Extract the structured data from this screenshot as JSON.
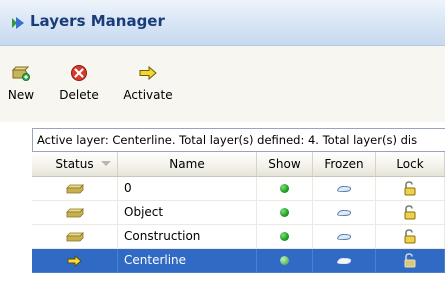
{
  "window": {
    "title": "Layers Manager"
  },
  "toolbar": {
    "new_label": "New",
    "delete_label": "Delete",
    "activate_label": "Activate"
  },
  "info": {
    "text": "Active layer: Centerline. Total layer(s) defined: 4. Total layer(s) dis"
  },
  "table": {
    "columns": [
      "Status",
      "Name",
      "Show",
      "Frozen",
      "Lock"
    ],
    "rows": [
      {
        "name": "0",
        "status": "folder",
        "show": "on",
        "frozen": "thawed",
        "lock": "unlocked",
        "selected": false
      },
      {
        "name": "Object",
        "status": "folder",
        "show": "on",
        "frozen": "thawed",
        "lock": "unlocked",
        "selected": false
      },
      {
        "name": "Construction",
        "status": "folder",
        "show": "on",
        "frozen": "thawed",
        "lock": "unlocked",
        "selected": false
      },
      {
        "name": "Centerline",
        "status": "active",
        "show": "on",
        "frozen": "thawed",
        "lock": "unlocked",
        "selected": true
      }
    ]
  },
  "colors": {
    "selection": "#316ac5",
    "title_text": "#1a3d7a",
    "show_on": "#1e9b1e"
  }
}
